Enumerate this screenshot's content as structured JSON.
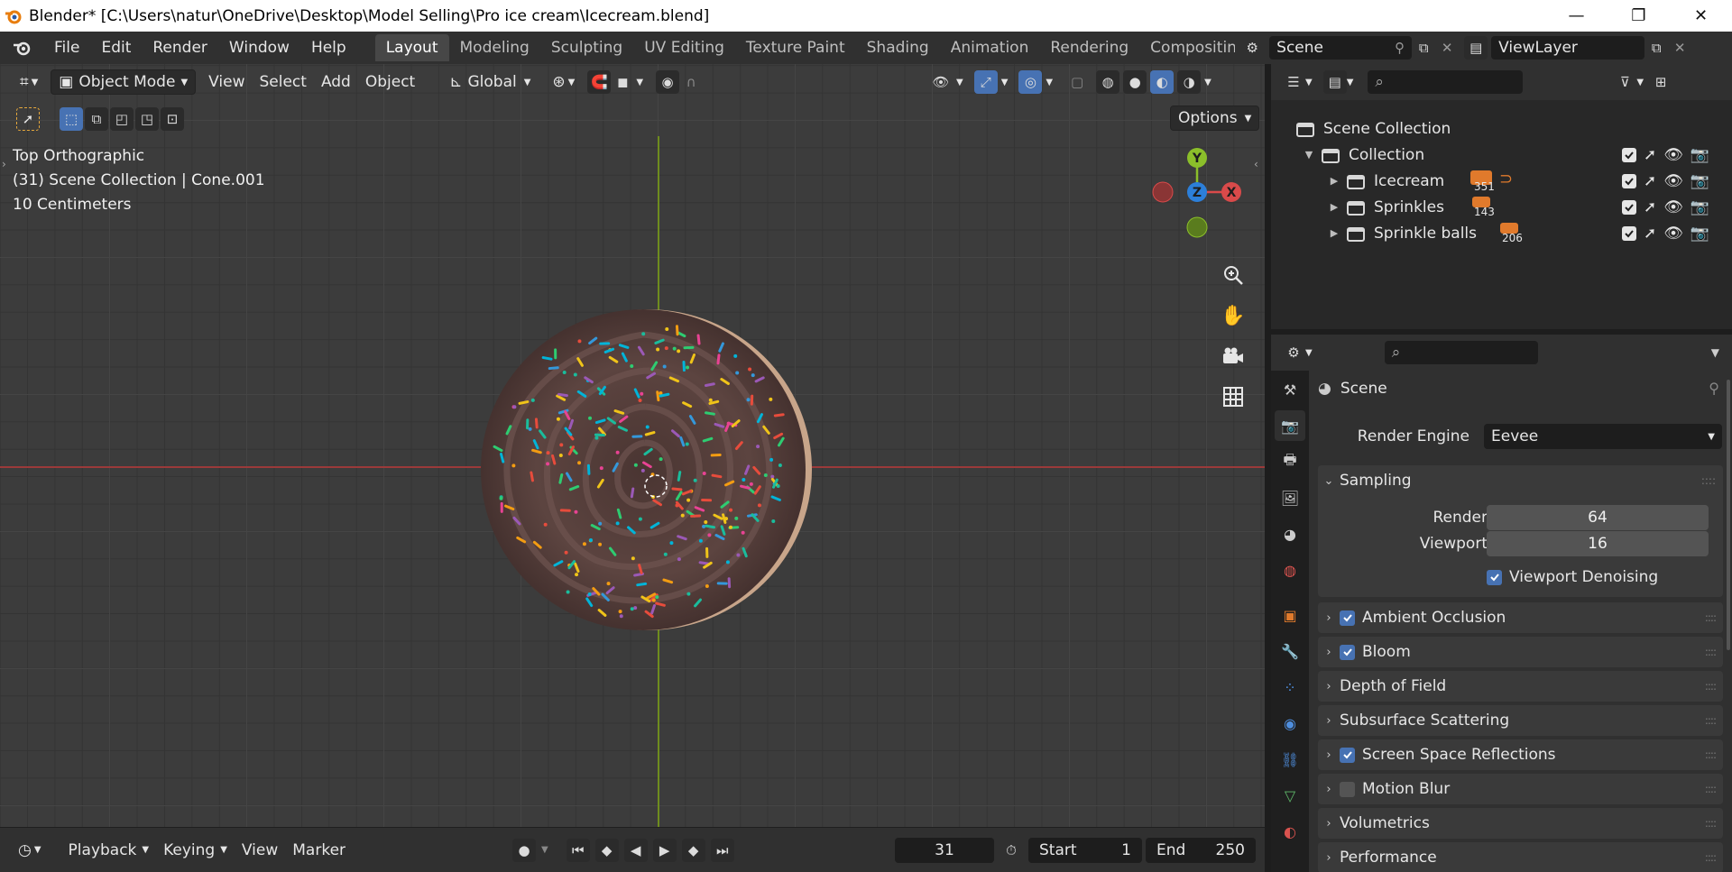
{
  "window": {
    "title": "Blender* [C:\\Users\\natur\\OneDrive\\Desktop\\Model Selling\\Pro ice cream\\Icecream.blend]",
    "minimize": "—",
    "restore": "❐",
    "close": "✕"
  },
  "menu": [
    "File",
    "Edit",
    "Render",
    "Window",
    "Help"
  ],
  "workspaces": [
    "Layout",
    "Modeling",
    "Sculpting",
    "UV Editing",
    "Texture Paint",
    "Shading",
    "Animation",
    "Rendering",
    "Compositin"
  ],
  "scene_name": "Scene",
  "view_layer": "ViewLayer",
  "viewport": {
    "mode": "Object Mode",
    "menus": [
      "View",
      "Select",
      "Add",
      "Object"
    ],
    "transform_orientation": "Global",
    "options_label": "Options",
    "overlay_lines": [
      "Top Orthographic",
      "(31) Scene Collection | Cone.001",
      "10 Centimeters"
    ],
    "gizmo": {
      "y": "Y",
      "z": "Z",
      "x": "X"
    }
  },
  "timeline": {
    "menus": [
      "Playback",
      "Keying",
      "View",
      "Marker"
    ],
    "current_frame": "31",
    "start_label": "Start",
    "start": "1",
    "end_label": "End",
    "end": "250"
  },
  "outliner": {
    "root": "Scene Collection",
    "collection": "Collection",
    "children": [
      {
        "name": "Icecream",
        "count": "351"
      },
      {
        "name": "Sprinkles",
        "count": "143"
      },
      {
        "name": "Sprinkle balls",
        "count": "206"
      }
    ]
  },
  "properties": {
    "context": "Scene",
    "render_engine_label": "Render Engine",
    "render_engine": "Eevee",
    "sampling": {
      "title": "Sampling",
      "render_label": "Render",
      "render": "64",
      "viewport_label": "Viewport",
      "viewport": "16",
      "denoise_label": "Viewport Denoising"
    },
    "panels": [
      {
        "label": "Ambient Occlusion",
        "checkbox": true,
        "checked": true
      },
      {
        "label": "Bloom",
        "checkbox": true,
        "checked": true
      },
      {
        "label": "Depth of Field",
        "checkbox": false
      },
      {
        "label": "Subsurface Scattering",
        "checkbox": false
      },
      {
        "label": "Screen Space Reflections",
        "checkbox": true,
        "checked": true
      },
      {
        "label": "Motion Blur",
        "checkbox": true,
        "checked": false
      },
      {
        "label": "Volumetrics",
        "checkbox": false
      },
      {
        "label": "Performance",
        "checkbox": false
      }
    ]
  },
  "colors": {
    "accent_blue": "#4772b3",
    "axis_x": "#d94a4a",
    "axis_y": "#8bbf2a",
    "axis_z": "#2c7fd9",
    "orange": "#e07a2c"
  }
}
